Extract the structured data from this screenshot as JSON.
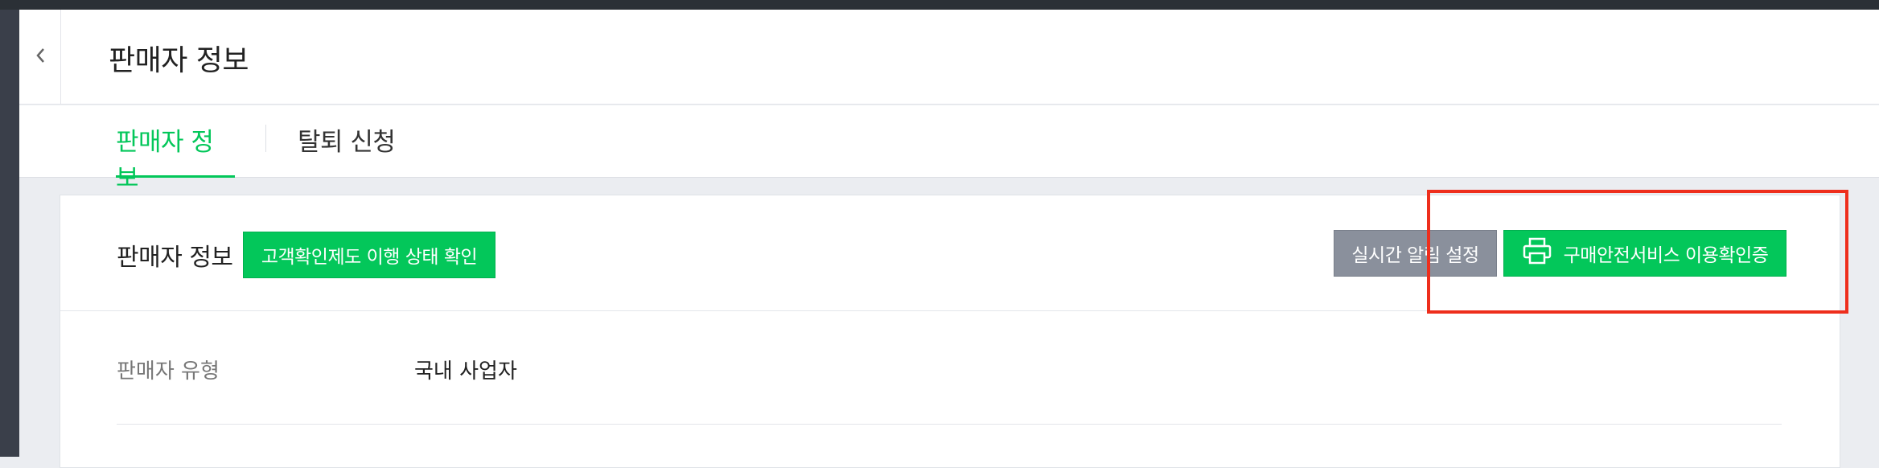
{
  "header": {
    "title": "판매자 정보",
    "back_icon": "chevron-left-icon"
  },
  "tabs": [
    {
      "label": "판매자 정보",
      "active": true
    },
    {
      "label": "탈퇴 신청",
      "active": false
    }
  ],
  "card": {
    "title": "판매자 정보",
    "status_button": "고객확인제도 이행 상태 확인",
    "alarm_button": "실시간 알림 설정",
    "certify_button": "구매안전서비스 이용확인증",
    "certify_icon": "printer-icon"
  },
  "rows": [
    {
      "label": "판매자 유형",
      "value": "국내 사업자"
    }
  ],
  "colors": {
    "accent": "#03c75a",
    "gray_button": "#8a909c",
    "highlight": "#ee2e1c"
  }
}
